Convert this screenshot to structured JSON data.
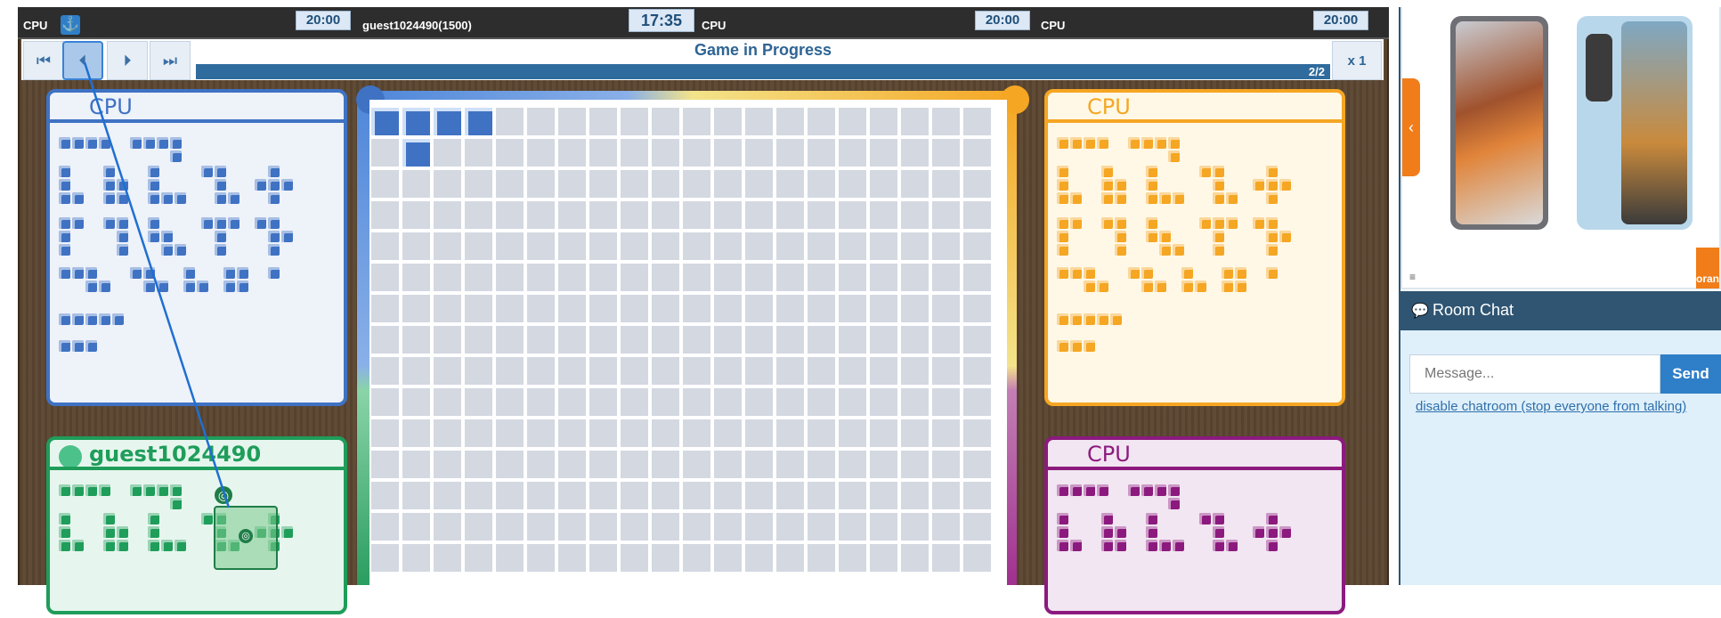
{
  "topbar": {
    "players": [
      {
        "name": "CPU",
        "clock": "20:00"
      },
      {
        "name": "guest1024490(1500)",
        "clock": "17:35"
      },
      {
        "name": "CPU",
        "clock": "20:00"
      },
      {
        "name": "CPU",
        "clock": "20:00"
      }
    ],
    "anchor_icon": "anchor-icon"
  },
  "controls": {
    "first": "⏮",
    "prev": "⏴",
    "next": "⏵",
    "last": "⏭",
    "status": "Game in Progress",
    "move_counter": "2/2",
    "speed": "x 1"
  },
  "panels": {
    "top_left": {
      "name": "CPU",
      "color": "#3f72c3",
      "bg": "#eef2f9"
    },
    "top_right": {
      "name": "CPU",
      "color": "#f5a623",
      "bg": "#fff8e6"
    },
    "bottom_left": {
      "name": "guest1024490",
      "color": "#1f9d5a",
      "bg": "#e6f6ee"
    },
    "bottom_right": {
      "name": "CPU",
      "color": "#8c1a7e",
      "bg": "#f1e6f1"
    }
  },
  "board": {
    "cols": 20,
    "visible_rows": 15,
    "player_colors": {
      "blue": "#3f72c3",
      "yellow": "#f5c04a",
      "green": "#2a9d5f",
      "purple": "#a0308f"
    },
    "placed_blue_cells": [
      [
        0,
        0
      ],
      [
        1,
        0
      ],
      [
        2,
        0
      ],
      [
        3,
        0
      ],
      [
        1,
        1
      ]
    ]
  },
  "sidebar": {
    "ad_brand": "oran",
    "chat_title": "Room Chat",
    "message_placeholder": "Message...",
    "send_label": "Send",
    "disable_link": "disable chatroom (stop everyone from talking)"
  }
}
